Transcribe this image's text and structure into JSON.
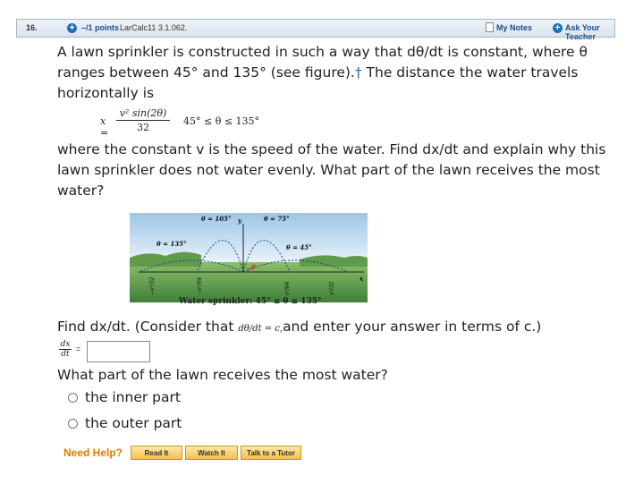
{
  "header": {
    "question_number": "16.",
    "points": "–/1 points",
    "source": "LarCalc11 3.1.062.",
    "my_notes": "My Notes",
    "ask_teacher": "Ask Your Teacher"
  },
  "problem": {
    "intro": "A lawn sprinkler is constructed in such a way that dθ/dt is constant, where θ ranges between 45° and 135° (see figure).",
    "dagger": "†",
    "intro_end": " The distance the water travels horizontally is",
    "formula_lhs": "x =",
    "formula_num": "v² sin(2θ)",
    "formula_den": "32",
    "formula_cond": "45° ≤ θ ≤ 135°",
    "mid": "where the constant v is the speed of the water. Find dx/dt and explain why this lawn sprinkler does not water evenly. What part of the lawn receives the most water?",
    "figure_caption": "Water sprinkler: 45° ≤ θ ≤ 135°",
    "figure_labels": {
      "t105": "θ = 105°",
      "t75": "θ = 75°",
      "t135": "θ = 135°",
      "t45": "θ = 45°",
      "y": "y",
      "x": "x",
      "theta": "θ",
      "n32": "−v²/32",
      "n64": "−v²/64",
      "p64": "v²/64",
      "p32": "v²/32"
    }
  },
  "part1": {
    "prompt_start": "Find dx/dt. (Consider that ",
    "prompt_small": "dθ/dt = c,",
    "prompt_end": "and enter your answer in terms of c.)",
    "label_num": "dx",
    "label_den": "dt",
    "eq": "=",
    "answer_value": ""
  },
  "part2": {
    "prompt": "What part of the lawn receives the most water?",
    "options": [
      "the inner part",
      "the outer part"
    ]
  },
  "help": {
    "label": "Need Help?",
    "read": "Read It",
    "watch": "Watch It",
    "tutor": "Talk to a Tutor"
  }
}
